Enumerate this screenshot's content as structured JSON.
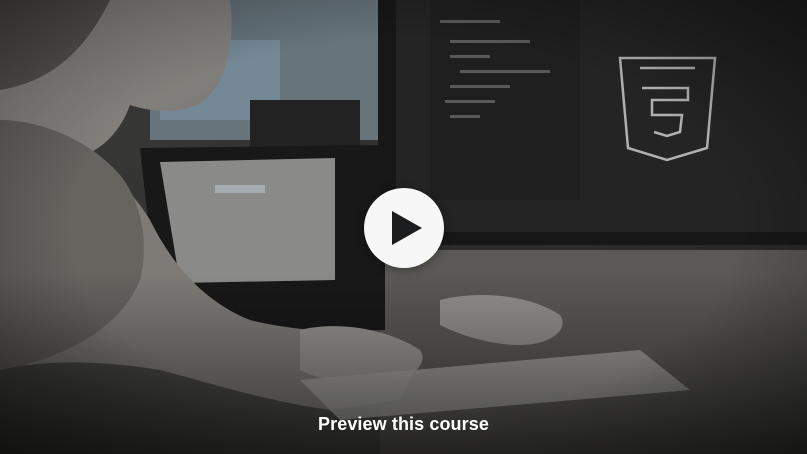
{
  "preview": {
    "label": "Preview this course",
    "play_icon": "play-icon",
    "logo_icon": "html5-icon",
    "overlay_color": "#000000",
    "play_button_color": "#f7f7f7"
  }
}
